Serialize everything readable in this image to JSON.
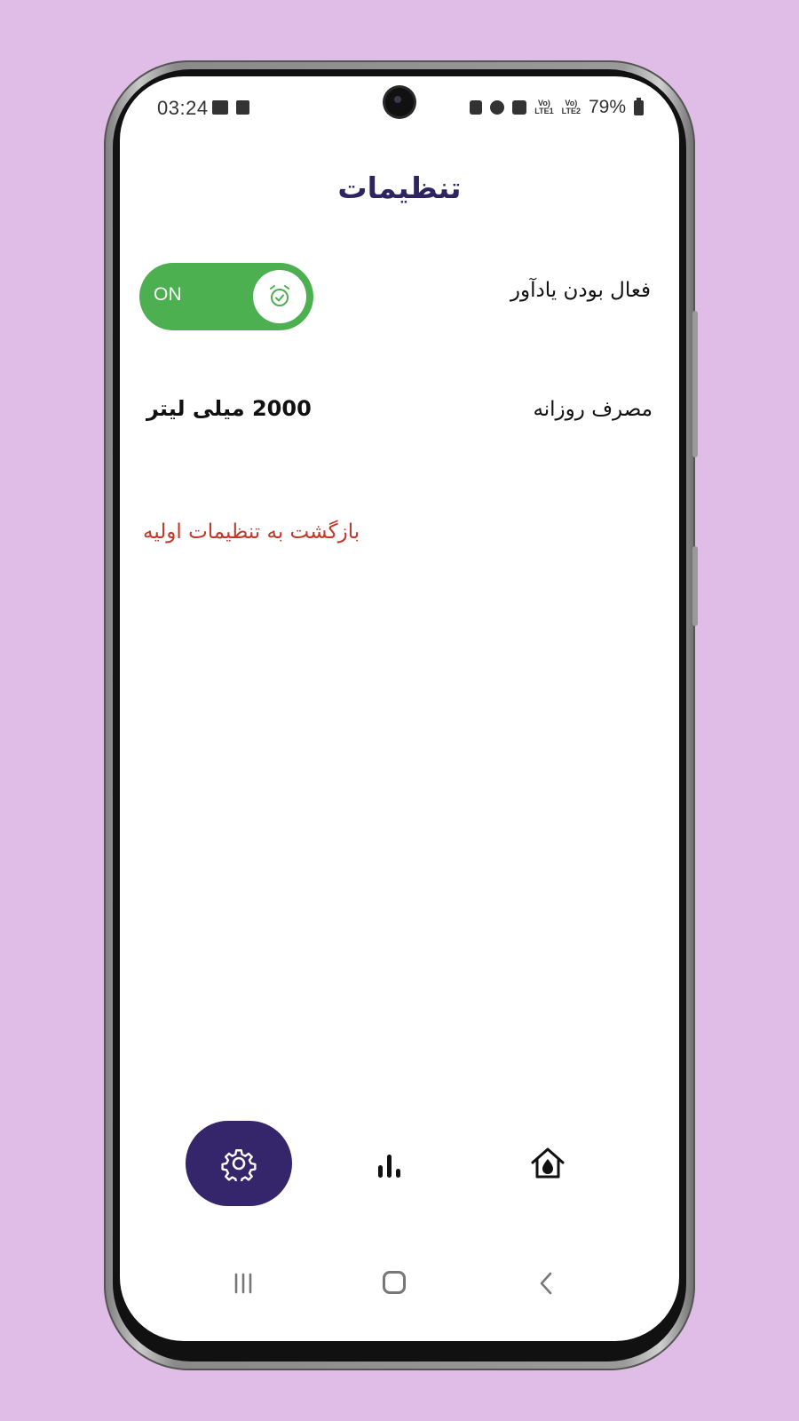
{
  "status_bar": {
    "time": "03:24",
    "sim1": "LTE1",
    "sim2": "LTE2",
    "battery": "79%"
  },
  "page": {
    "title": "تنظیمات"
  },
  "settings": {
    "reminder": {
      "label": "فعال بودن یادآور",
      "toggle_text": "ON",
      "enabled": true,
      "icon": "alarm-check-icon"
    },
    "daily_intake": {
      "label": "مصرف روزانه",
      "value": "2000 میلی لیتر"
    },
    "reset": {
      "label": "بازگشت به تنظیمات اولیه"
    }
  },
  "bottom_nav": {
    "items": [
      {
        "id": "settings",
        "icon": "gear-icon",
        "active": true
      },
      {
        "id": "stats",
        "icon": "bar-chart-icon",
        "active": false
      },
      {
        "id": "home",
        "icon": "water-home-icon",
        "active": false
      }
    ]
  },
  "colors": {
    "background": "#e0bde7",
    "title": "#2e2460",
    "toggle_on": "#4caf50",
    "nav_active": "#35256a",
    "reset": "#c0392b"
  }
}
